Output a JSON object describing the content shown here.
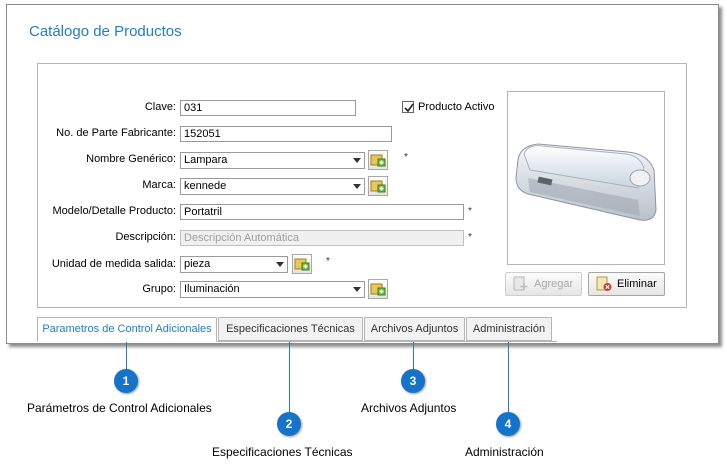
{
  "window": {
    "title": "Catálogo de Productos"
  },
  "form": {
    "clave": {
      "label": "Clave:",
      "value": "031"
    },
    "parte": {
      "label": "No. de Parte Fabricante:",
      "value": "152051"
    },
    "nombre": {
      "label": "Nombre Genérico:",
      "value": "Lampara",
      "required": "*"
    },
    "marca": {
      "label": "Marca:",
      "value": "kennede"
    },
    "modelo": {
      "label": "Modelo/Detalle Producto:",
      "value": "Portatril",
      "required": "*"
    },
    "descripcion": {
      "label": "Descripción:",
      "placeholder": "Descripción Automática",
      "required": "*"
    },
    "unidad": {
      "label": "Unidad de medida salida:",
      "value": "pieza",
      "required": "*"
    },
    "grupo": {
      "label": "Grupo:",
      "value": "Iluminación"
    },
    "activo": {
      "label": "Producto Activo",
      "checked": true
    }
  },
  "image": {
    "icon": "product-photo-lamp"
  },
  "buttons": {
    "agregar": "Agregar",
    "eliminar": "Eliminar"
  },
  "tabs": [
    {
      "label": "Parametros de Control Adicionales",
      "active": true
    },
    {
      "label": "Especificaciones Técnicas"
    },
    {
      "label": "Archivos Adjuntos"
    },
    {
      "label": "Administración"
    }
  ],
  "callouts": [
    {
      "number": "1",
      "text": "Parámetros de Control Adicionales"
    },
    {
      "number": "2",
      "text": "Especificaciones Técnicas"
    },
    {
      "number": "3",
      "text": "Archivos Adjuntos"
    },
    {
      "number": "4",
      "text": "Administración"
    }
  ],
  "colors": {
    "accent": "#1f7fc4",
    "marker": "#1573c9"
  }
}
